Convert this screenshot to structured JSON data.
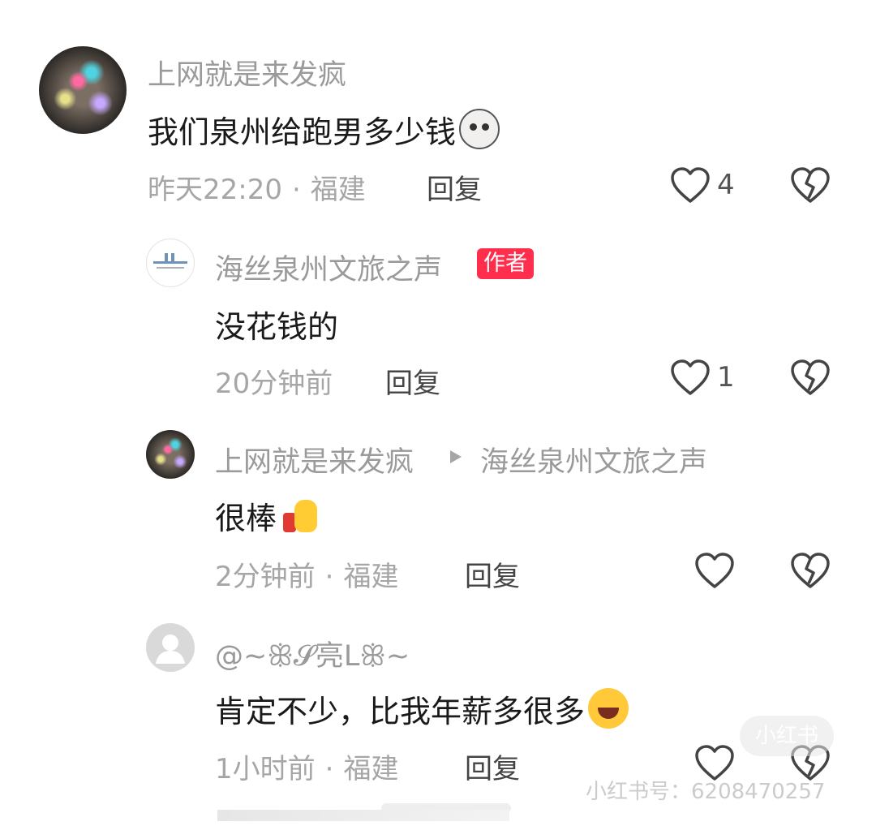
{
  "comments": [
    {
      "user": "上网就是来发疯",
      "text": "我们泉州给跑男多少钱",
      "time": "昨天22:20",
      "location": "福建",
      "reply_label": "回复",
      "likes": "4"
    },
    {
      "user": "海丝泉州文旅之声",
      "badge": "作者",
      "text": "没花钱的",
      "time": "20分钟前",
      "reply_label": "回复",
      "likes": "1"
    },
    {
      "user": "上网就是来发疯",
      "reply_to": "海丝泉州文旅之声",
      "text": "很棒",
      "time": "2分钟前",
      "location": "福建",
      "reply_label": "回复"
    },
    {
      "user": "@~ꕥ𝓢亮Lꕥ~",
      "text": "肯定不少，比我年薪多很多",
      "time": "1小时前",
      "location": "福建",
      "reply_label": "回复"
    }
  ],
  "watermark": {
    "badge": "小红书",
    "text": "小红书号：6208470257"
  },
  "colors": {
    "author_badge": "#ff2e4d",
    "meta_text": "#a6a6a6",
    "name_text": "#9a9a9a"
  },
  "icons": [
    "heart-icon",
    "broken-heart-icon",
    "play-arrow-icon"
  ]
}
